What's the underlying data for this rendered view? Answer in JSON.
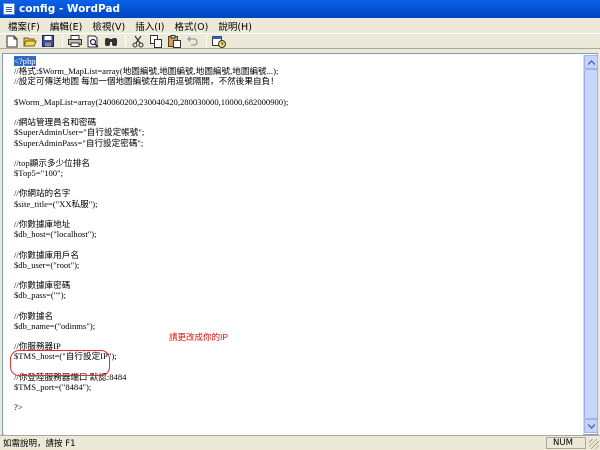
{
  "window": {
    "title": "config - WordPad",
    "app_icon": "wordpad-document-icon"
  },
  "menu": [
    "檔案(F)",
    "編輯(E)",
    "檢視(V)",
    "插入(I)",
    "格式(O)",
    "說明(H)"
  ],
  "toolbar": {
    "buttons": [
      "new-icon",
      "open-icon",
      "save-icon",
      "print-icon",
      "print-preview-icon",
      "find-icon",
      "cut-icon",
      "copy-icon",
      "paste-icon",
      "undo-icon",
      "date-time-icon"
    ]
  },
  "document": {
    "lines": [
      "<?php",
      "//格式:$Worm_MapList=array(地圖編號,地圖編號,地圖編號,地圖編號...);",
      "//設定可傳送地圖 每加一個地圖編號在前用逗號隔開，不然後果自負！",
      "",
      "$Worm_MapList=array(240060200,230040420,280030000,10000,682000900);",
      "",
      "//網站管理員名和密碼",
      "$SuperAdminUser=\"自行設定帳號\";",
      "$SuperAdminPass=\"自行設定密碼\";",
      "",
      "//top顯示多少位排名",
      "$Top5=\"100\";",
      "",
      "//你網站的名字",
      "$site_title=(\"XX私服\");",
      "",
      "//你數據庫地址",
      "$db_host=(\"localhost\");",
      "",
      "//你數據庫用戶名",
      "$db_user=(\"root\");",
      "",
      "//你數據庫密碼",
      "$db_pass=(\"\");",
      "",
      "//你數據名",
      "$db_name=(\"odinms\");",
      "",
      "//你服務器IP",
      "$TMS_host=(\"自行設定IP\");",
      "",
      "//你登陸服務器端口 默認:8484",
      "$TMS_port=(\"8484\");",
      "",
      "?>"
    ],
    "annotation": "請更改成你的IP"
  },
  "status": {
    "help_text": "如需說明，請按 F1",
    "num_indicator": "NUM"
  },
  "colors": {
    "titlebar": "#0054e3",
    "selection": "#316ac5",
    "annotation": "#e01010"
  }
}
